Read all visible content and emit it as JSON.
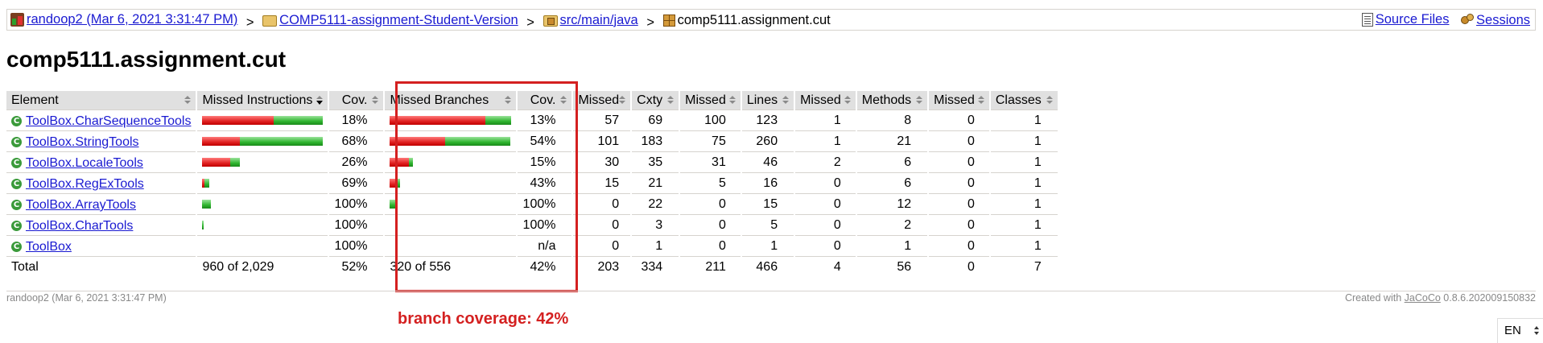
{
  "breadcrumb": {
    "items": [
      {
        "label": "randoop2 (Mar 6, 2021 3:31:47 PM)",
        "icon": "session-icon"
      },
      {
        "label": "COMP5111-assignment-Student-Version",
        "icon": "folder-icon"
      },
      {
        "label": "src/main/java",
        "icon": "package-folder-icon"
      },
      {
        "label": "comp5111.assignment.cut",
        "icon": "package-icon"
      }
    ],
    "separator": ">",
    "source_files": "Source Files",
    "sessions": "Sessions"
  },
  "page_title": "comp5111.assignment.cut",
  "table": {
    "headers": [
      "Element",
      "Missed Instructions",
      "Cov.",
      "Missed Branches",
      "Cov.",
      "Missed",
      "Cxty",
      "Missed",
      "Lines",
      "Missed",
      "Methods",
      "Missed",
      "Classes"
    ],
    "rows": [
      {
        "element": "ToolBox.CharSequenceTools",
        "instr_missed": 0.59,
        "instr_covered": 0.41,
        "instr_cov": "18%",
        "branch_missed": 0.79,
        "branch_covered": 0.21,
        "branch_cov": "13%",
        "cxty_missed": "57",
        "cxty": "69",
        "lines_missed": "100",
        "lines": "123",
        "methods_missed": "1",
        "methods": "8",
        "classes_missed": "0",
        "classes": "1"
      },
      {
        "element": "ToolBox.StringTools",
        "instr_missed": 0.31,
        "instr_covered": 0.69,
        "instr_cov": "68%",
        "branch_missed": 0.46,
        "branch_covered": 0.54,
        "branch_cov": "54%",
        "cxty_missed": "101",
        "cxty": "183",
        "lines_missed": "75",
        "lines": "260",
        "methods_missed": "1",
        "methods": "21",
        "classes_missed": "0",
        "classes": "1"
      },
      {
        "element": "ToolBox.LocaleTools",
        "instr_missed": 0.23,
        "instr_covered": 0.08,
        "instr_cov": "26%",
        "branch_missed": 0.16,
        "branch_covered": 0.03,
        "branch_cov": "15%",
        "cxty_missed": "30",
        "cxty": "35",
        "lines_missed": "31",
        "lines": "46",
        "methods_missed": "2",
        "methods": "6",
        "classes_missed": "0",
        "classes": "1"
      },
      {
        "element": "ToolBox.RegExTools",
        "instr_missed": 0.02,
        "instr_covered": 0.04,
        "instr_cov": "69%",
        "branch_missed": 0.05,
        "branch_covered": 0.03,
        "branch_cov": "43%",
        "cxty_missed": "15",
        "cxty": "21",
        "lines_missed": "5",
        "lines": "16",
        "methods_missed": "0",
        "methods": "6",
        "classes_missed": "0",
        "classes": "1"
      },
      {
        "element": "ToolBox.ArrayTools",
        "instr_missed": 0.0,
        "instr_covered": 0.07,
        "instr_cov": "100%",
        "branch_missed": 0.0,
        "branch_covered": 0.05,
        "branch_cov": "100%",
        "cxty_missed": "0",
        "cxty": "22",
        "lines_missed": "0",
        "lines": "15",
        "methods_missed": "0",
        "methods": "12",
        "classes_missed": "0",
        "classes": "1"
      },
      {
        "element": "ToolBox.CharTools",
        "instr_missed": 0.0,
        "instr_covered": 0.015,
        "instr_cov": "100%",
        "branch_missed": 0.0,
        "branch_covered": 0.0,
        "branch_cov": "100%",
        "cxty_missed": "0",
        "cxty": "3",
        "lines_missed": "0",
        "lines": "5",
        "methods_missed": "0",
        "methods": "2",
        "classes_missed": "0",
        "classes": "1"
      },
      {
        "element": "ToolBox",
        "instr_missed": 0.0,
        "instr_covered": 0.0,
        "instr_cov": "100%",
        "branch_missed": 0.0,
        "branch_covered": 0.0,
        "branch_cov": "n/a",
        "cxty_missed": "0",
        "cxty": "1",
        "lines_missed": "0",
        "lines": "1",
        "methods_missed": "0",
        "methods": "1",
        "classes_missed": "0",
        "classes": "1"
      }
    ],
    "total": {
      "label": "Total",
      "instr": "960 of 2,029",
      "instr_cov": "52%",
      "branch": "320 of 556",
      "branch_cov": "42%",
      "cxty_missed": "203",
      "cxty": "334",
      "lines_missed": "211",
      "lines": "466",
      "methods_missed": "4",
      "methods": "56",
      "classes_missed": "0",
      "classes": "7"
    }
  },
  "annotation": "branch coverage: 42%",
  "footer": {
    "left": "randoop2 (Mar 6, 2021 3:31:47 PM)",
    "created_with": "Created with",
    "jacoco": "JaCoCo",
    "version": "0.8.6.202009150832"
  },
  "language": "EN",
  "colors": {
    "highlight": "#d42020",
    "bar_red": "#e02020",
    "bar_green": "#2fb52f",
    "link": "#1a1ad1"
  }
}
